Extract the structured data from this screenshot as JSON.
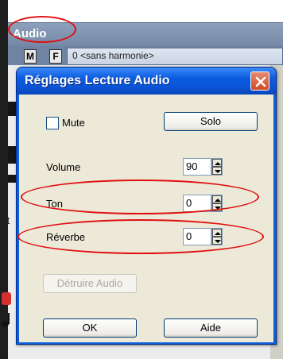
{
  "background": {
    "panel_title": "Audio",
    "mini_buttons": [
      "M",
      "F"
    ],
    "harmony_value": "0 <sans harmonie>",
    "side_label": "St"
  },
  "dialog": {
    "title": "Réglages Lecture Audio",
    "mute_label": "Mute",
    "mute_checked": false,
    "solo_label": "Solo",
    "volume_label": "Volume",
    "volume_value": "90",
    "ton_label": "Ton",
    "ton_value": "0",
    "reverbe_label": "Réverbe",
    "reverbe_value": "0",
    "destroy_label": "Détruire Audio",
    "ok_label": "OK",
    "help_label": "Aide"
  },
  "colors": {
    "titlebar": "#0a5be0",
    "client_bg": "#ece9d8",
    "annotation": "#e01010"
  }
}
